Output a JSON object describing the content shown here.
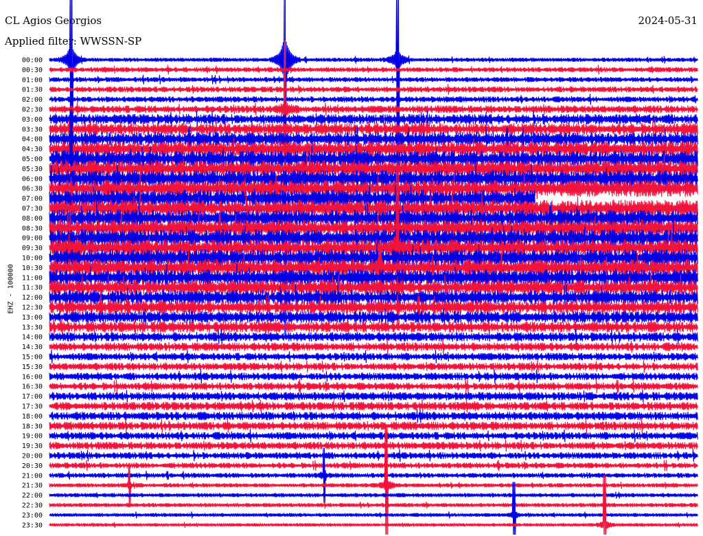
{
  "header": {
    "station": "CL Agios Georgios",
    "filter": "Applied filter: WWSSN-SP",
    "date": "2024-05-31"
  },
  "component_label": "EHZ - 100000",
  "chart_data": {
    "type": "line",
    "title": "CL Agios Georgios",
    "subtitle": "Applied filter: WWSSN-SP",
    "ylabel": "EHZ - 100000",
    "row_labels": [
      "00:00",
      "00:30",
      "01:00",
      "01:30",
      "02:00",
      "02:30",
      "03:00",
      "03:30",
      "04:00",
      "04:30",
      "05:00",
      "05:30",
      "06:00",
      "06:30",
      "07:00",
      "07:30",
      "08:00",
      "08:30",
      "09:00",
      "09:30",
      "10:00",
      "10:30",
      "11:00",
      "11:30",
      "12:00",
      "12:30",
      "13:00",
      "13:30",
      "14:00",
      "14:30",
      "15:00",
      "15:30",
      "16:00",
      "16:30",
      "17:00",
      "17:30",
      "18:00",
      "18:30",
      "19:00",
      "19:30",
      "20:00",
      "20:30",
      "21:00",
      "21:30",
      "22:00",
      "22:30",
      "23:00",
      "23:30"
    ],
    "minutes_per_row": 30,
    "colors": [
      "#0000e6",
      "#f0143c"
    ],
    "noise_amplitude": [
      0.5,
      0.6,
      0.6,
      0.7,
      0.7,
      0.9,
      1.2,
      1.4,
      1.6,
      1.8,
      1.9,
      2.0,
      2.0,
      2.0,
      2.0,
      2.0,
      2.0,
      2.0,
      2.0,
      2.0,
      2.0,
      2.0,
      1.9,
      1.8,
      1.7,
      1.6,
      1.4,
      1.3,
      1.1,
      1.0,
      0.9,
      0.9,
      0.9,
      0.9,
      1.0,
      1.0,
      1.0,
      1.0,
      0.9,
      0.9,
      0.8,
      0.7,
      0.6,
      0.5,
      0.5,
      0.5,
      0.45,
      0.4
    ],
    "data_gaps": [
      {
        "row": 14,
        "start_minute": 22.5,
        "end_minute": 30
      }
    ],
    "events": [
      {
        "row": 0,
        "minute": 1.0,
        "amplitude": 60
      },
      {
        "row": 0,
        "minute": 10.9,
        "amplitude": 100
      },
      {
        "row": 0,
        "minute": 16.1,
        "amplitude": 40
      },
      {
        "row": 5,
        "minute": 10.9,
        "amplitude": 25
      },
      {
        "row": 10,
        "minute": 1.0,
        "amplitude": 18
      },
      {
        "row": 19,
        "minute": 16.1,
        "amplitude": 30
      },
      {
        "row": 21,
        "minute": 15.3,
        "amplitude": 10
      },
      {
        "row": 42,
        "minute": 12.7,
        "amplitude": 10
      },
      {
        "row": 43,
        "minute": 15.6,
        "amplitude": 22
      },
      {
        "row": 43,
        "minute": 3.7,
        "amplitude": 8
      },
      {
        "row": 46,
        "minute": 21.5,
        "amplitude": 12
      },
      {
        "row": 47,
        "minute": 25.7,
        "amplitude": 18
      }
    ]
  }
}
